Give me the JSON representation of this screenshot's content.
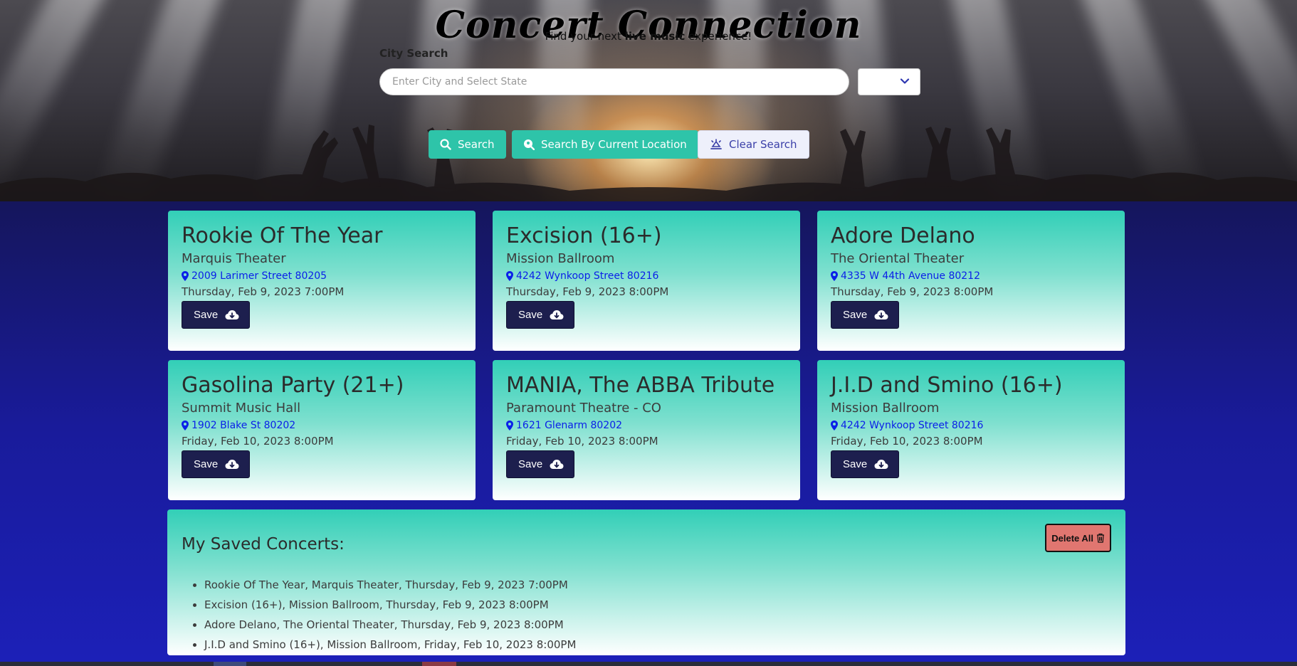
{
  "header": {
    "title": "Concert Connection",
    "tagline_pre": "Find your next ",
    "tagline_bold": "live music",
    "tagline_post": " experience!"
  },
  "search": {
    "label": "City Search",
    "placeholder": "Enter City and Select State",
    "value": "",
    "state_value": ""
  },
  "buttons": {
    "search": "Search",
    "location": "Search By Current Location",
    "clear": "Clear Search"
  },
  "concerts": [
    {
      "title": "Rookie Of The Year",
      "venue": "Marquis Theater",
      "address": "2009 Larimer Street 80205",
      "date": "Thursday, Feb 9, 2023 7:00PM",
      "save": "Save"
    },
    {
      "title": "Excision (16+)",
      "venue": "Mission Ballroom",
      "address": "4242 Wynkoop Street 80216",
      "date": "Thursday, Feb 9, 2023 8:00PM",
      "save": "Save"
    },
    {
      "title": "Adore Delano",
      "venue": "The Oriental Theater",
      "address": "4335 W 44th Avenue 80212",
      "date": "Thursday, Feb 9, 2023 8:00PM",
      "save": "Save"
    },
    {
      "title": "Gasolina Party (21+)",
      "venue": "Summit Music Hall",
      "address": "1902 Blake St 80202",
      "date": "Friday, Feb 10, 2023 8:00PM",
      "save": "Save"
    },
    {
      "title": "MANIA, The ABBA Tribute",
      "venue": "Paramount Theatre - CO",
      "address": "1621 Glenarm 80202",
      "date": "Friday, Feb 10, 2023 8:00PM",
      "save": "Save"
    },
    {
      "title": "J.I.D and Smino (16+)",
      "venue": "Mission Ballroom",
      "address": "4242 Wynkoop Street 80216",
      "date": "Friday, Feb 10, 2023 8:00PM",
      "save": "Save"
    }
  ],
  "saved": {
    "title": "My Saved Concerts:",
    "delete_label": "Delete All",
    "items": [
      "Rookie Of The Year, Marquis Theater, Thursday, Feb 9, 2023 7:00PM",
      "Excision (16+), Mission Ballroom, Thursday, Feb 9, 2023 8:00PM",
      "Adore Delano, The Oriental Theater, Thursday, Feb 9, 2023 8:00PM",
      "J.I.D and Smino (16+), Mission Ballroom, Friday, Feb 10, 2023 8:00PM"
    ]
  },
  "icons": {
    "search": "magnifier-icon",
    "location": "location-search-icon",
    "clear": "clear-icon",
    "pin": "map-pin-icon",
    "save": "cloud-download-icon",
    "delete": "trash-icon",
    "dropdown": "chevron-down-icon"
  },
  "colors": {
    "accent": "#2ec4a9",
    "page_bg": "#1a1c9a",
    "save_button": "#1d1f4e",
    "delete_button": "#e07670",
    "link": "#0b20e8"
  }
}
